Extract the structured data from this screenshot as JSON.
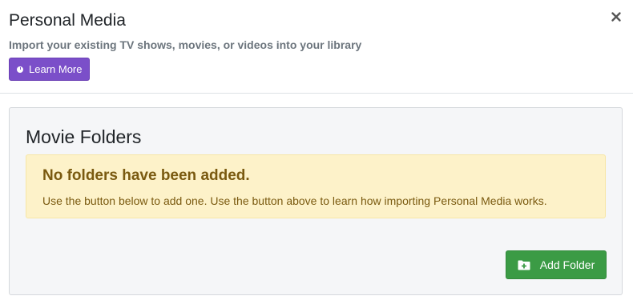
{
  "header": {
    "title": "Personal Media",
    "subtitle": "Import your existing TV shows, movies, or videos into your library",
    "learn_more_label": "Learn More",
    "close_icon": "close-icon"
  },
  "panel": {
    "title": "Movie Folders",
    "alert": {
      "heading": "No folders have been added.",
      "text": "Use the button below to add one. Use the button above to learn how importing Personal Media works."
    },
    "add_folder_label": "Add Folder",
    "add_folder_icon": "folder-plus-icon"
  },
  "colors": {
    "learn_more_bg": "#7b4fc9",
    "add_folder_bg": "#3b9b45",
    "alert_bg": "#fdf2c9",
    "alert_text": "#7a5a10",
    "panel_bg": "#f5f6f8"
  }
}
